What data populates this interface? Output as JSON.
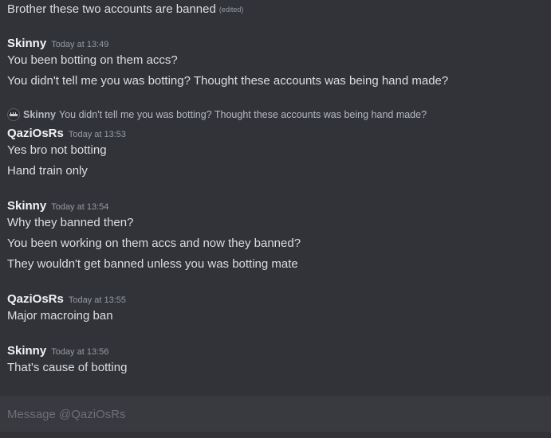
{
  "messages": {
    "m0": {
      "text": "Brother these two accounts are banned",
      "edited": "(edited)"
    },
    "g1": {
      "author": "Skinny",
      "time": "Today at 13:49",
      "l1": "You been botting on them accs?",
      "l2": "You didn't tell me you was botting? Thought these accounts was being hand made?"
    },
    "reply": {
      "author": "Skinny",
      "text": "You didn't tell me you was botting? Thought these accounts was being hand made?"
    },
    "g2": {
      "author": "QaziOsRs",
      "time": "Today at 13:53",
      "l1": "Yes bro not botting",
      "l2": "Hand train only"
    },
    "g3": {
      "author": "Skinny",
      "time": "Today at 13:54",
      "l1": "Why they banned then?",
      "l2": "You been working on them accs and now they banned?",
      "l3": "They wouldn't get banned unless you was botting mate"
    },
    "g4": {
      "author": "QaziOsRs",
      "time": "Today at 13:55",
      "l1": "Major macroing ban"
    },
    "g5": {
      "author": "Skinny",
      "time": "Today at 13:56",
      "l1": "That's cause of botting"
    }
  },
  "input": {
    "placeholder": "Message @QaziOsRs"
  }
}
